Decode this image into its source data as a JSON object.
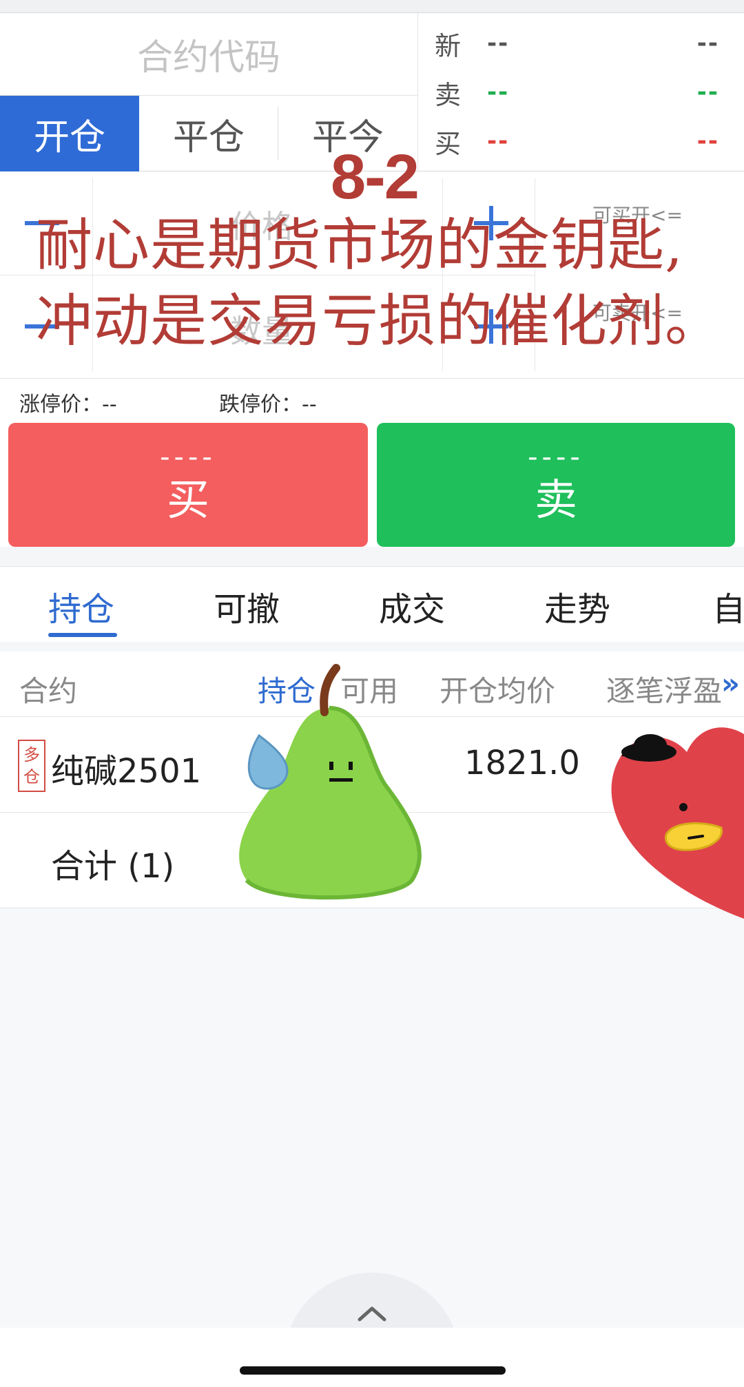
{
  "order_panel": {
    "contract_code_placeholder": "合约代码",
    "tabs": [
      {
        "label": "开仓",
        "active": true
      },
      {
        "label": "平仓",
        "active": false
      },
      {
        "label": "平今",
        "active": false
      }
    ],
    "quote": [
      {
        "label": "新",
        "bid": "--",
        "ask": "--",
        "color": "#555555"
      },
      {
        "label": "卖",
        "bid": "--",
        "ask": "--",
        "color": "#1fae4e"
      },
      {
        "label": "买",
        "bid": "--",
        "ask": "--",
        "color": "#e0403a"
      }
    ],
    "price_placeholder": "价格",
    "quantity_placeholder": "数量",
    "max_open_label": "可买开<=",
    "max_open_label_2": "可卖开<="
  },
  "overlay": {
    "badge": "8-2",
    "line1": "耐心是期货市场的金钥匙,",
    "line2": "冲动是交易亏损的催化剂。"
  },
  "limits": {
    "up": "涨停价：--",
    "down": "跌停价：--"
  },
  "trade_buttons": {
    "buy": {
      "price": "----",
      "label": "买",
      "color": "#f45e5e"
    },
    "sell": {
      "price": "----",
      "label": "卖",
      "color": "#1fbf5b"
    }
  },
  "lower_tabs": [
    {
      "label": "持仓",
      "active": true
    },
    {
      "label": "可撤",
      "active": false
    },
    {
      "label": "成交",
      "active": false
    },
    {
      "label": "走势",
      "active": false
    },
    {
      "label": "自",
      "active": false
    }
  ],
  "positions": {
    "headers": [
      "合约",
      "持仓",
      "可用",
      "开仓均价",
      "逐笔浮盈"
    ],
    "more_icon": "double-chevron-right-icon",
    "rows": [
      {
        "tag": "多仓",
        "tag_top": "多",
        "tag_bottom": "仓",
        "contract": "纯碱2501",
        "open_avg_price": "1821.0"
      }
    ],
    "total_label": "合计 (1)"
  },
  "stickers": [
    "pear-sticker",
    "heart-sticker"
  ],
  "accent_color": "#2f6bd0"
}
